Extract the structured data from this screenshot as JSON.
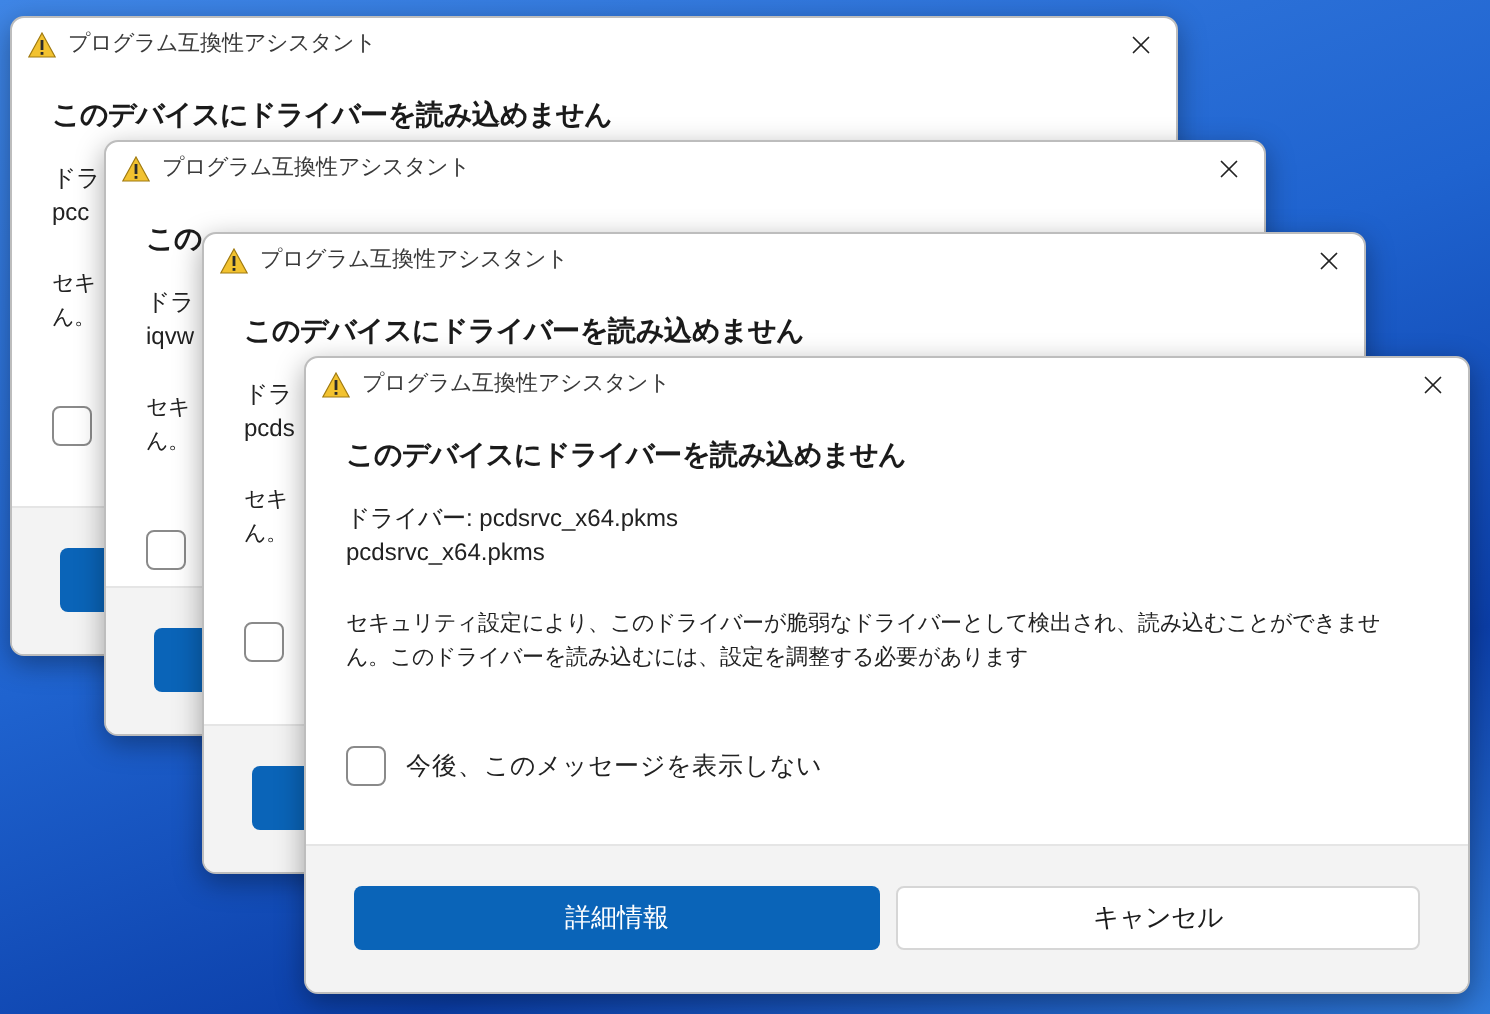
{
  "windows": [
    {
      "title": "プログラム互換性アシスタント",
      "heading": "このデバイスにドライバーを読み込めません",
      "driver_lines": [
        "ドラ",
        "pcc"
      ],
      "message_lines": [
        "セキ",
        "ん。"
      ],
      "checkbox": {
        "checked": false
      },
      "buttons": [
        {
          "kind": "primary"
        }
      ]
    },
    {
      "title": "プログラム互換性アシスタント",
      "heading": "この",
      "driver_lines": [
        "ドラ",
        "iqvw"
      ],
      "message_lines": [
        "セキ",
        "ん。"
      ],
      "checkbox": {
        "checked": false
      },
      "buttons": [
        {
          "kind": "primary"
        }
      ]
    },
    {
      "title": "プログラム互換性アシスタント",
      "heading": "このデバイスにドライバーを読み込めません",
      "driver_lines": [
        "ドラ",
        "pcds"
      ],
      "message_lines": [
        "セキ",
        "ん。"
      ],
      "checkbox": {
        "checked": false
      },
      "buttons": [
        {
          "kind": "primary"
        }
      ]
    },
    {
      "title": "プログラム互換性アシスタント",
      "heading": "このデバイスにドライバーを読み込めません",
      "driver_lines": [
        "ドライバー: pcdsrvc_x64.pkms",
        "pcdsrvc_x64.pkms"
      ],
      "message_lines": [
        "セキュリティ設定により、このドライバーが脆弱なドライバーとして検出され、読み込むことができませ",
        "ん。このドライバーを読み込むには、設定を調整する必要があります"
      ],
      "checkbox": {
        "checked": false,
        "label": "今後、このメッセージを表示しない"
      },
      "buttons": [
        {
          "kind": "primary",
          "label": "詳細情報"
        },
        {
          "kind": "secondary",
          "label": "キャンセル"
        }
      ]
    }
  ]
}
